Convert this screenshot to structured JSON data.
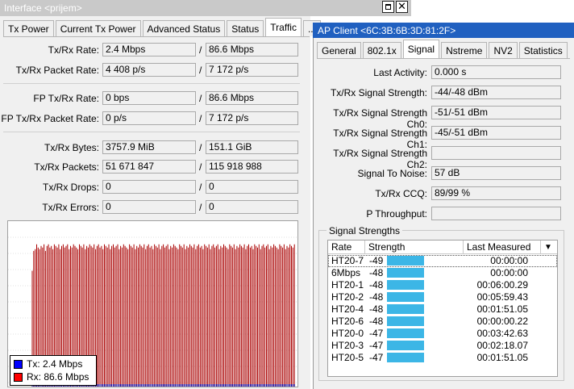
{
  "left_window": {
    "title": "Interface <prijem>",
    "tabs": [
      {
        "label": "Tx Power"
      },
      {
        "label": "Current Tx Power"
      },
      {
        "label": "Advanced Status"
      },
      {
        "label": "Status"
      },
      {
        "label": "Traffic"
      },
      {
        "label": "..."
      }
    ],
    "fields": {
      "txrx_rate": {
        "label": "Tx/Rx Rate:",
        "tx": "2.4 Mbps",
        "rx": "86.6 Mbps"
      },
      "txrx_packet_rate": {
        "label": "Tx/Rx Packet Rate:",
        "tx": "4 408 p/s",
        "rx": "7 172 p/s"
      },
      "fp_txrx_rate": {
        "label": "FP Tx/Rx Rate:",
        "tx": "0 bps",
        "rx": "86.6 Mbps"
      },
      "fp_txrx_packet_rate": {
        "label": "FP Tx/Rx Packet Rate:",
        "tx": "0 p/s",
        "rx": "7 172 p/s"
      },
      "txrx_bytes": {
        "label": "Tx/Rx Bytes:",
        "tx": "3757.9 MiB",
        "rx": "151.1 GiB"
      },
      "txrx_packets": {
        "label": "Tx/Rx Packets:",
        "tx": "51 671 847",
        "rx": "115 918 988"
      },
      "txrx_drops": {
        "label": "Tx/Rx Drops:",
        "tx": "0",
        "rx": "0"
      },
      "txrx_errors": {
        "label": "Tx/Rx Errors:",
        "tx": "0",
        "rx": "0"
      }
    },
    "separator": "/",
    "legend": {
      "tx": "Tx:  2.4 Mbps",
      "rx": "Rx:  86.6 Mbps",
      "tx_color": "#0000ff",
      "rx_color": "#ff0000"
    },
    "traffic_graph": {
      "rx_color": "#aa0000",
      "tx_color": "#0000aa",
      "rx_levels": [
        0.7,
        0.82,
        0.83,
        0.86,
        0.84,
        0.83,
        0.85,
        0.84,
        0.86,
        0.82,
        0.85,
        0.86,
        0.84,
        0.85,
        0.83,
        0.86,
        0.85,
        0.84,
        0.86,
        0.83,
        0.85,
        0.86,
        0.84,
        0.85,
        0.86,
        0.83,
        0.85,
        0.84,
        0.86,
        0.85,
        0.84,
        0.83,
        0.86,
        0.85,
        0.84,
        0.86,
        0.83,
        0.85,
        0.84,
        0.86,
        0.85,
        0.84,
        0.86,
        0.83,
        0.85,
        0.86,
        0.84,
        0.85,
        0.83,
        0.86,
        0.85,
        0.84,
        0.86,
        0.83,
        0.85,
        0.86,
        0.84,
        0.85,
        0.86,
        0.83,
        0.85,
        0.84,
        0.86,
        0.85,
        0.84,
        0.83,
        0.86,
        0.85,
        0.84,
        0.86,
        0.83,
        0.85,
        0.84,
        0.86,
        0.85,
        0.84,
        0.86,
        0.83,
        0.85,
        0.86,
        0.84,
        0.85,
        0.83,
        0.86,
        0.85,
        0.84,
        0.86,
        0.83,
        0.85,
        0.86,
        0.84,
        0.85,
        0.86,
        0.83,
        0.85,
        0.84,
        0.86,
        0.85,
        0.84,
        0.83,
        0.86,
        0.85,
        0.84,
        0.86,
        0.83,
        0.85,
        0.84,
        0.86,
        0.85,
        0.84,
        0.86,
        0.83,
        0.85,
        0.86,
        0.84,
        0.85,
        0.83,
        0.86,
        0.85,
        0.84,
        0.86,
        0.83,
        0.85,
        0.86,
        0.84,
        0.85,
        0.86,
        0.83,
        0.85,
        0.84,
        0.86,
        0.85,
        0.84,
        0.83,
        0.86,
        0.85,
        0.84,
        0.86,
        0.83,
        0.85,
        0.84,
        0.86,
        0.85,
        0.84,
        0.86,
        0.83,
        0.85,
        0.86,
        0.84,
        0.85,
        0.83,
        0.86,
        0.85,
        0.84,
        0.86,
        0.83,
        0.85,
        0.86,
        0.84,
        0.85,
        0.86,
        0.83,
        0.85,
        0.84,
        0.86,
        0.85,
        0.84,
        0.83,
        0.86,
        0.85,
        0.84,
        0.86,
        0.83,
        0.85,
        0.84,
        0.86,
        0.85,
        0.84,
        0.86
      ]
    }
  },
  "right_window": {
    "title": "AP Client <6C:3B:6B:3D:81:2F>",
    "tabs": [
      {
        "label": "General"
      },
      {
        "label": "802.1x"
      },
      {
        "label": "Signal"
      },
      {
        "label": "Nstreme"
      },
      {
        "label": "NV2"
      },
      {
        "label": "Statistics"
      }
    ],
    "fields": [
      {
        "label": "Last Activity:",
        "value": "0.000 s"
      },
      {
        "label": "Tx/Rx Signal Strength:",
        "value": "-44/-48 dBm"
      },
      {
        "label": "Tx/Rx Signal Strength Ch0:",
        "value": "-51/-51 dBm"
      },
      {
        "label": "Tx/Rx Signal Strength Ch1:",
        "value": "-45/-51 dBm"
      },
      {
        "label": "Tx/Rx Signal Strength Ch2:",
        "value": ""
      },
      {
        "label": "Signal To Noise:",
        "value": "57 dB"
      },
      {
        "label": "Tx/Rx CCQ:",
        "value": "89/99 %"
      },
      {
        "label": "P Throughput:",
        "value": ""
      }
    ],
    "signal_strengths": {
      "group_label": "Signal Strengths",
      "columns": [
        "Rate",
        "Strength",
        "Last Measured"
      ],
      "bar_color": "#3cb6e6",
      "rows": [
        {
          "rate": "HT20-7",
          "strength": "-49",
          "last": "00:00:00"
        },
        {
          "rate": "6Mbps",
          "strength": "-48",
          "last": "00:00:00"
        },
        {
          "rate": "HT20-1",
          "strength": "-48",
          "last": "00:06:00.29"
        },
        {
          "rate": "HT20-2",
          "strength": "-48",
          "last": "00:05:59.43"
        },
        {
          "rate": "HT20-4",
          "strength": "-48",
          "last": "00:01:51.05"
        },
        {
          "rate": "HT20-6",
          "strength": "-48",
          "last": "00:00:00.22"
        },
        {
          "rate": "HT20-0",
          "strength": "-47",
          "last": "00:03:42.63"
        },
        {
          "rate": "HT20-3",
          "strength": "-47",
          "last": "00:02:18.07"
        },
        {
          "rate": "HT20-5",
          "strength": "-47",
          "last": "00:01:51.05"
        }
      ]
    }
  }
}
